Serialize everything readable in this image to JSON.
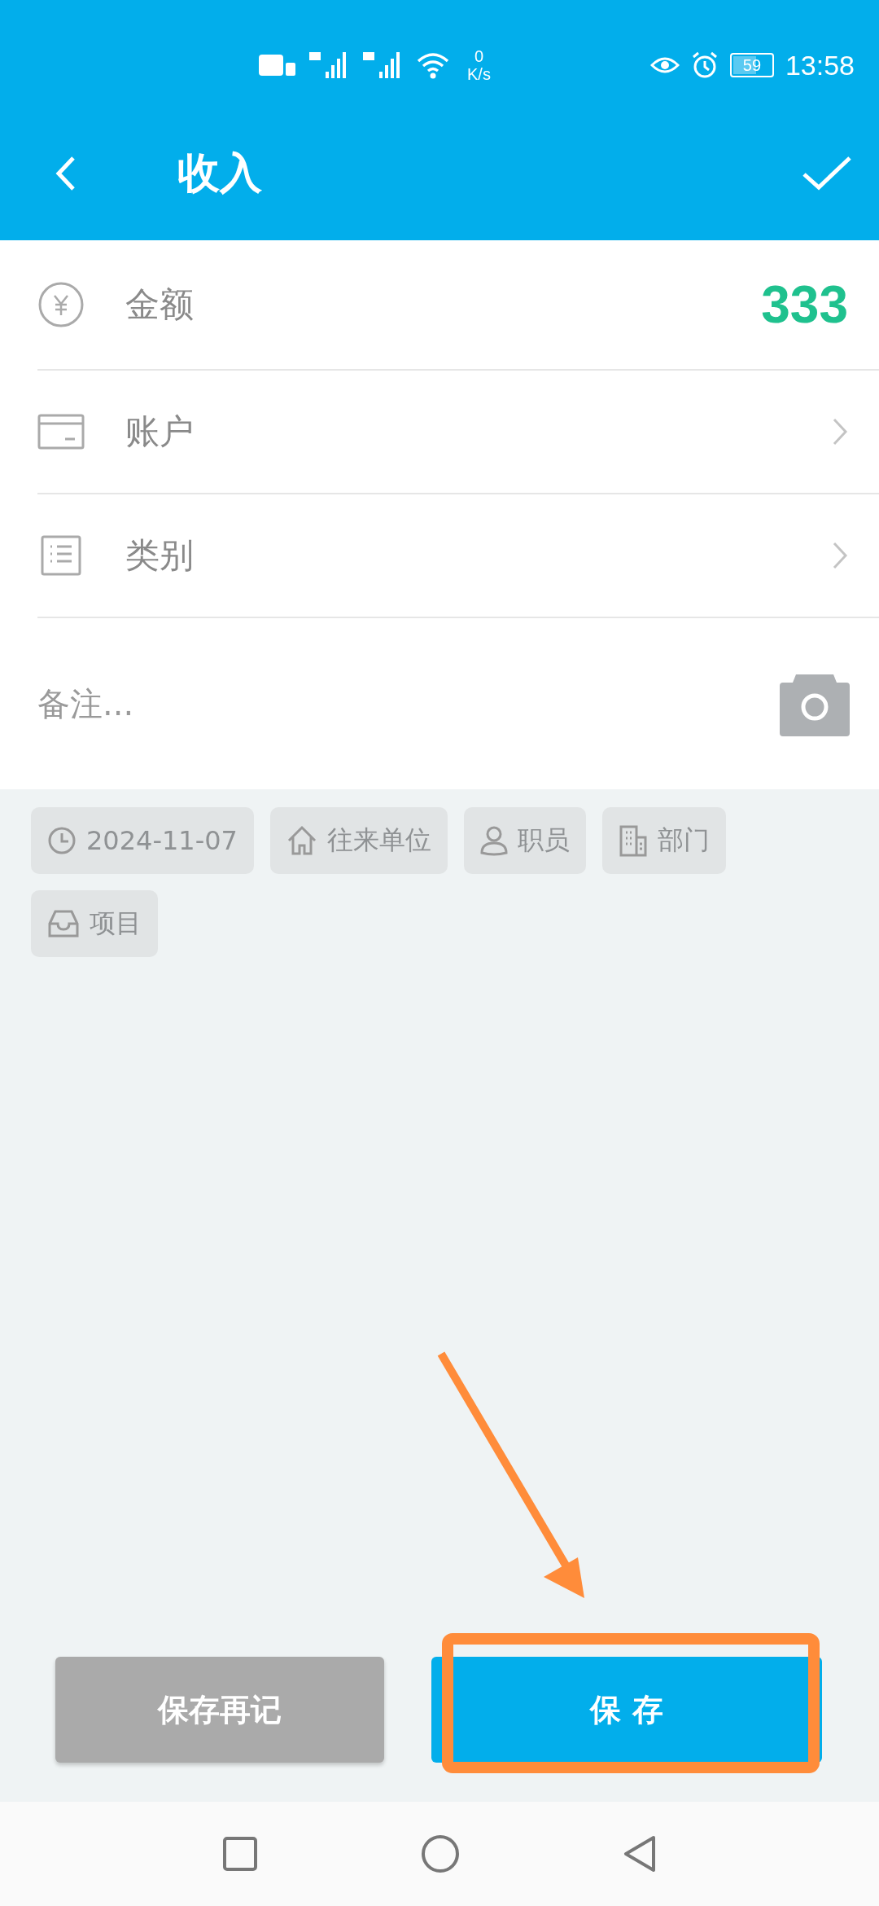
{
  "status_bar": {
    "speed_value": "0",
    "speed_unit": "K/s",
    "battery": "59",
    "time": "13:58"
  },
  "header": {
    "title": "收入"
  },
  "form_rows": [
    {
      "kind": "value",
      "label": "金额",
      "value": "333"
    },
    {
      "kind": "link",
      "label": "账户"
    },
    {
      "kind": "link",
      "label": "类别"
    }
  ],
  "note": {
    "placeholder": "备注..."
  },
  "chips": [
    {
      "label": "2024-11-07"
    },
    {
      "label": "往来单位"
    },
    {
      "label": "职员"
    },
    {
      "label": "部门"
    },
    {
      "label": "项目"
    }
  ],
  "buttons": [
    {
      "kind": "secondary",
      "label": "保存再记"
    },
    {
      "kind": "primary",
      "label": "保 存"
    }
  ]
}
